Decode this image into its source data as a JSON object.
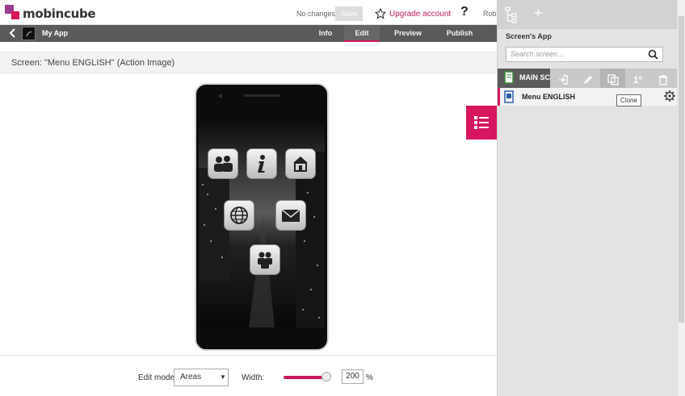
{
  "topbar": {
    "logo_text": "mobincube",
    "status": "No changes",
    "save_label": "Save",
    "upgrade_label": "Upgrade account",
    "help_label": "?",
    "user_label": "Robe"
  },
  "appbar": {
    "app_name": "My App",
    "tabs": [
      "Info",
      "Edit",
      "Preview",
      "Publish"
    ],
    "active_tab": "Edit"
  },
  "screen": {
    "title": "Screen: \"Menu ENGLISH\" (Action Image)"
  },
  "editor": {
    "edit_mode_label": "Edit mode:",
    "edit_mode_value": "Areas",
    "width_label": "Width:",
    "width_value": "200",
    "width_unit": "%",
    "width_level_percent": 85
  },
  "panel": {
    "add_label": "+",
    "title": "Screen's App",
    "search_placeholder": "Search screen...",
    "main_row_label": "MAIN SCREEN",
    "tools": [
      "exit-icon",
      "pencil-icon",
      "clone-icon",
      "first-icon",
      "trash-icon"
    ],
    "first_tool_label": "1º",
    "menu_item": "Menu ENGLISH",
    "tooltip": "Clone"
  },
  "colors": {
    "accent": "#d6175f",
    "appbar": "#5a5a5a",
    "panel": "#e3e3e3"
  }
}
